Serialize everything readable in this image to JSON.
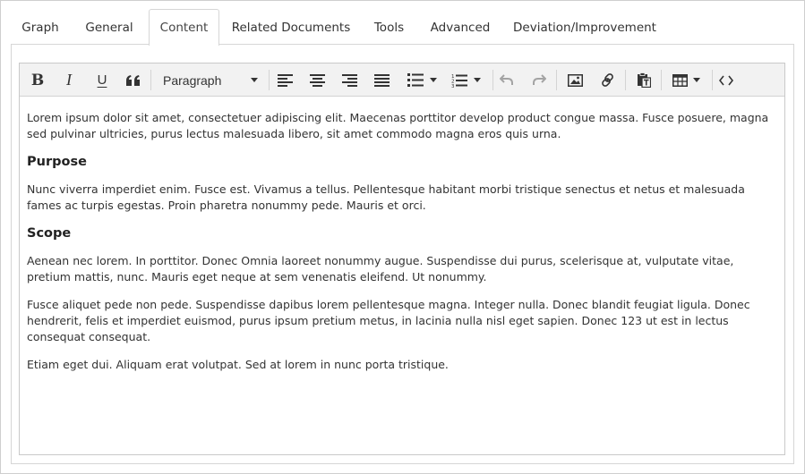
{
  "tabs": [
    {
      "label": "Graph",
      "active": false
    },
    {
      "label": "General",
      "active": false
    },
    {
      "label": "Content",
      "active": true
    },
    {
      "label": "Related Documents",
      "active": false
    },
    {
      "label": "Tools",
      "active": false
    },
    {
      "label": "Advanced",
      "active": false
    },
    {
      "label": "Deviation/Improvement",
      "active": false
    }
  ],
  "toolbar": {
    "bold_label": "B",
    "italic_label": "I",
    "underline_label": "U",
    "format_select_value": "Paragraph",
    "icons": [
      "bold-icon",
      "italic-icon",
      "underline-icon",
      "blockquote-icon",
      "align-left-icon",
      "align-center-icon",
      "align-right-icon",
      "align-justify-icon",
      "bullet-list-icon",
      "numbered-list-icon",
      "undo-icon",
      "redo-icon",
      "image-icon",
      "link-icon",
      "paste-text-icon",
      "table-icon",
      "source-code-icon"
    ]
  },
  "content": {
    "intro": "Lorem ipsum dolor sit amet, consectetuer adipiscing elit. Maecenas porttitor develop product congue massa. Fusce posuere, magna sed pulvinar ultricies, purus lectus malesuada libero, sit amet commodo magna eros quis urna.",
    "purpose_heading": "Purpose",
    "purpose_text": "Nunc viverra imperdiet enim. Fusce est. Vivamus a tellus. Pellentesque habitant morbi tristique senectus et netus et malesuada fames ac turpis egestas. Proin pharetra nonummy pede. Mauris et orci.",
    "scope_heading": "Scope",
    "scope_text_1": "Aenean nec lorem. In porttitor. Donec Omnia laoreet nonummy augue. Suspendisse dui purus, scelerisque at, vulputate vitae, pretium mattis, nunc. Mauris eget neque at sem venenatis eleifend. Ut nonummy.",
    "scope_text_2": "Fusce aliquet pede non pede. Suspendisse dapibus lorem pellentesque magna. Integer nulla. Donec blandit feugiat ligula. Donec hendrerit, felis et imperdiet euismod, purus ipsum pretium metus, in lacinia nulla nisl eget sapien. Donec 123 ut est in lectus consequat consequat.",
    "scope_text_3": "Etiam eget dui. Aliquam erat volutpat. Sed at lorem in nunc porta tristique."
  },
  "colors": {
    "toolbar_bg": "#f2f2f2",
    "border": "#d6d6d6",
    "text": "#333333",
    "disabled_icon": "#a3a3a3"
  }
}
